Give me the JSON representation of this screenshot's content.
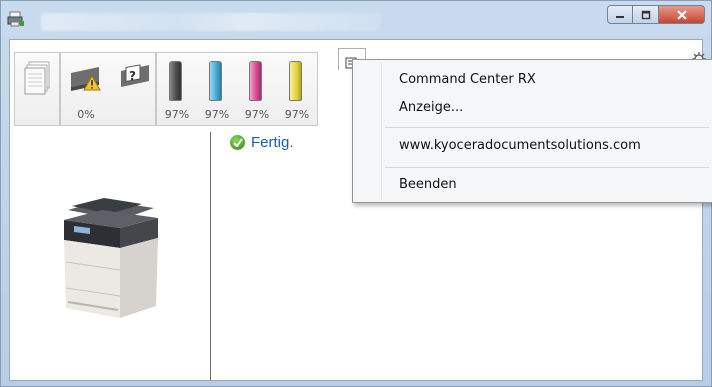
{
  "window": {
    "title": ""
  },
  "supplies": {
    "paper_percent": "0%",
    "toners": [
      {
        "name": "black",
        "percent": "97%",
        "color": "#4a4a4a"
      },
      {
        "name": "cyan",
        "percent": "97%",
        "color": "#3fa9d6"
      },
      {
        "name": "magenta",
        "percent": "97%",
        "color": "#d6468f"
      },
      {
        "name": "yellow",
        "percent": "97%",
        "color": "#e3d43a"
      }
    ]
  },
  "status": {
    "text": "Fertig."
  },
  "menu": {
    "items": [
      {
        "label": "Command Center RX"
      },
      {
        "label": "Anzeige..."
      },
      {
        "label": "www.kyoceradocumentsolutions.com"
      },
      {
        "label": "Beenden"
      }
    ]
  },
  "icons": {
    "app": "printer-icon",
    "paper": "paper-stack-icon",
    "warning": "warning-icon",
    "help": "help-icon",
    "status": "check-icon",
    "menu_trigger": "settings-icon"
  }
}
